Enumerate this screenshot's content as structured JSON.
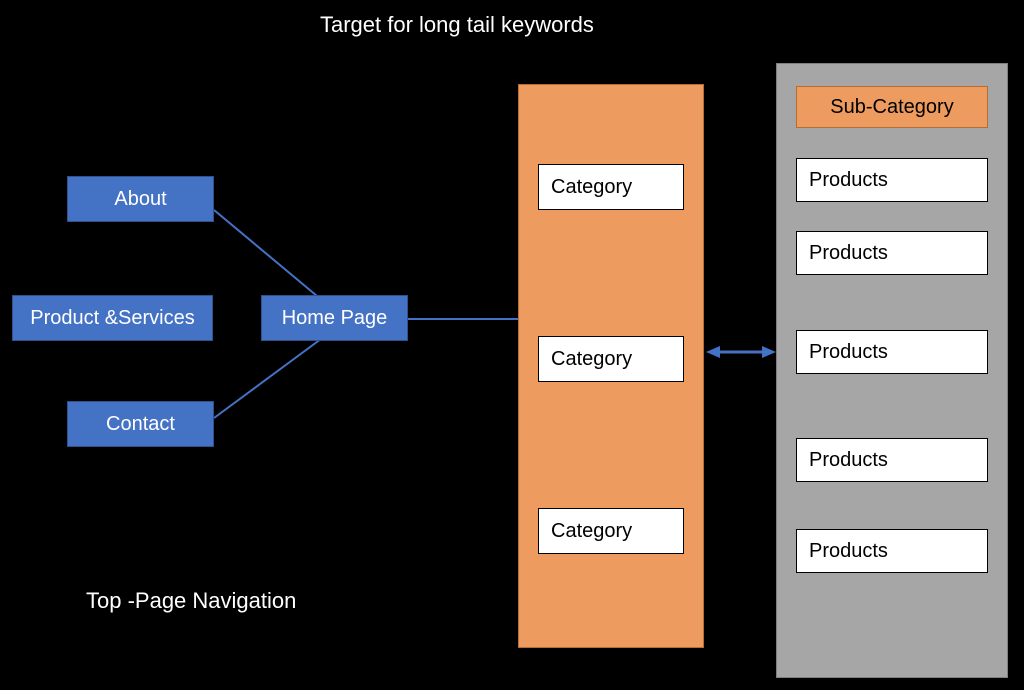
{
  "title": "Target for long tail keywords",
  "nav": {
    "about": "About",
    "products_services": "Product &Services",
    "home": "Home  Page",
    "contact": "Contact",
    "caption": "Top -Page Navigation"
  },
  "category_panel": {
    "items": [
      "Category",
      "Category",
      "Category"
    ]
  },
  "subcategory_panel": {
    "header": "Sub-Category",
    "items": [
      "Products",
      "Products",
      "Products",
      "Products",
      "Products"
    ]
  },
  "colors": {
    "blue": "#4472c4",
    "orange": "#ed9b5f",
    "gray": "#a6a6a6"
  }
}
